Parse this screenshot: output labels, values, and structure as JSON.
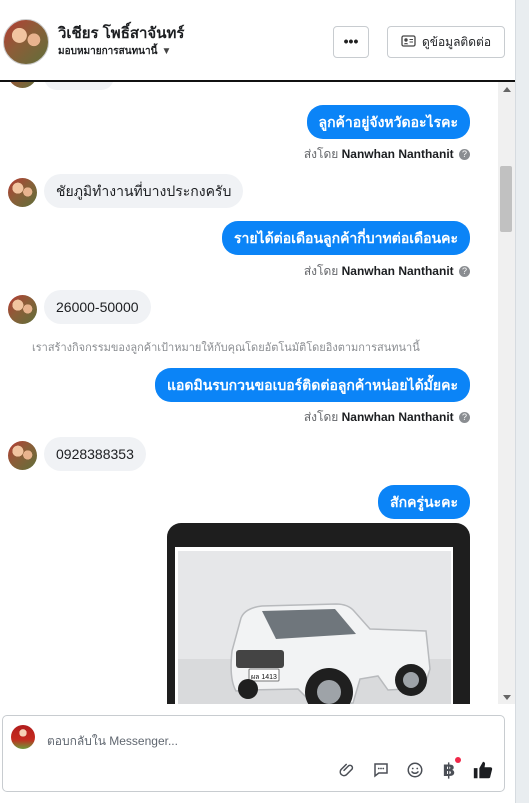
{
  "header": {
    "name": "วิเชียร โพธิ์สาจันทร์",
    "assign_label": "มอบหมายการสนทนานี้",
    "more_label": "•••",
    "contact_label": "ดูข้อมูลติดต่อ"
  },
  "thread": {
    "msg1": "ลูกค้าอยู่จังหวัดอะไรคะ",
    "sent_prefix": "ส่งโดย",
    "sender_name": "Nanwhan Nanthanit",
    "help_glyph": "?",
    "reply1": "ชัยภูมิทำงานที่บางประกงครับ",
    "msg2": "รายได้ต่อเดือนลูกค้ากี่บาทต่อเดือนคะ",
    "reply2": "26000-50000",
    "system_note": "เราสร้างกิจกรรมของลูกค้าเป้าหมายให้กับคุณโดยอัตโนมัติโดยอิงตามการสนทนานี้",
    "msg3": "แอดมินรบกวนขอเบอร์ติดต่อลูกค้าหน่อยได้มั้ยคะ",
    "reply3": "0928388353",
    "msg4": "สักครู่นะคะ",
    "plate": "ผล 1413"
  },
  "composer": {
    "placeholder": "ตอบกลับใน Messenger...",
    "icons": [
      "paperclip-icon",
      "speech-bubble-icon",
      "smile-icon",
      "baht-icon",
      "thumbs-up-icon"
    ]
  },
  "colors": {
    "accent": "#0b84f7",
    "incoming": "#f0f2f5"
  }
}
